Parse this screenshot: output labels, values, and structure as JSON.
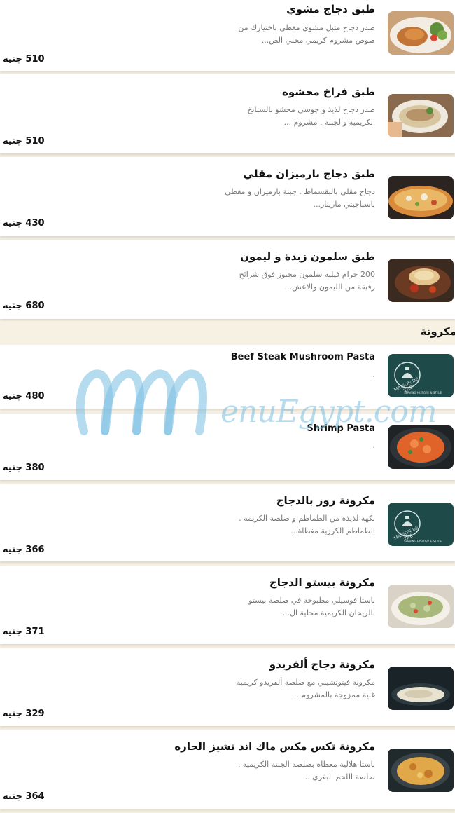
{
  "items": [
    {
      "name": "طبق دجاج مشوي",
      "desc": "صدر دجاج متبل مشوي مغطى باختيارك من صوص مشروم كريمي محلي الص...",
      "price": "510 جنيه",
      "image": "grilled-chicken"
    },
    {
      "name": "طبق فراخ محشوه",
      "desc": "صدر دجاج لذيذ و جوسي محشو بالسبانخ الكريمية والجبنة . مشروم ...",
      "price": "510 جنيه",
      "image": "stuffed-chicken"
    },
    {
      "name": "طبق دجاج بارميزان مقلي",
      "desc": "دجاج مقلي بالبقسماط . جبنة بارميزان و مغطي باسباجيتي مارينار...",
      "price": "430 جنيه",
      "image": "parmesan-chicken"
    },
    {
      "name": "طبق سلمون زبدة و ليمون",
      "desc": "200 جرام فيليه سلمون مخبوز فوق شرائح رقيقة من الليمون والاعش...",
      "price": "680 جنيه",
      "image": "salmon"
    }
  ],
  "section": {
    "title": "مكرونة"
  },
  "pasta": [
    {
      "name": "Beef Steak Mushroom Pasta",
      "desc": ".",
      "price": "480 جنيه",
      "image": "maison-logo"
    },
    {
      "name": "Shrimp Pasta",
      "desc": ".",
      "price": "380 جنيه",
      "image": "shrimp-pasta"
    },
    {
      "name": "مكرونة روز بالدجاج",
      "desc": "نكهة لذيذة من الطماطم و صلصة الكريمة . الطماطم الكرزية مغطاة...",
      "price": "366 جنيه",
      "image": "maison-logo"
    },
    {
      "name": "مكرونة بيستو الدجاج",
      "desc": "باستا فوسيلي مطبوخة في صلصة بيستو بالريحان الكريمية محلية ال...",
      "price": "371 جنيه",
      "image": "pesto-pasta"
    },
    {
      "name": "مكرونة دجاج ألفريدو",
      "desc": "مكرونة فيتوتشيني مع صلصة ألفريدو كريمية غنية ممزوجة بالمشروم...",
      "price": "329 جنيه",
      "image": "alfredo"
    },
    {
      "name": "مكرونة تكس مكس ماك اند تشيز الحاره",
      "desc": "باستا هلالية مغطاه بصلصة الجبنة الكريمية . صلصة اللحم البقري...",
      "price": "364 جنيه",
      "image": "mac-cheese"
    }
  ],
  "logo": {
    "text": "MAISON DE THÉ",
    "subtext": "SERVING HISTORY & STYLE"
  },
  "watermark": {
    "text": "enuEgypt.com"
  }
}
